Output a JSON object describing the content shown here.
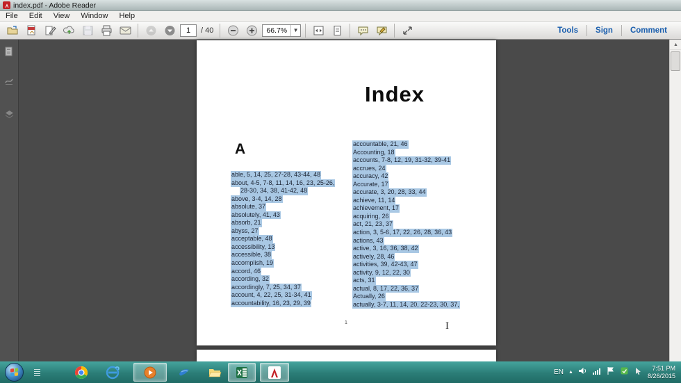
{
  "window": {
    "title": "index.pdf - Adobe Reader"
  },
  "menu": {
    "items": [
      "File",
      "Edit",
      "View",
      "Window",
      "Help"
    ]
  },
  "toolbar": {
    "icons": [
      "open-icon",
      "send-file-icon",
      "sign-pen-icon",
      "cloud-upload-icon",
      "save-icon",
      "print-icon",
      "email-icon",
      "previous-page-icon",
      "next-page-icon",
      "zoom-out-icon",
      "zoom-in-icon",
      "fit-width-icon",
      "fit-page-icon",
      "comment-bubble-icon",
      "annotate-bubble-icon",
      "fullscreen-icon"
    ],
    "page_current": "1",
    "page_total": "/ 40",
    "zoom_level": "66.7%",
    "right_buttons": [
      "Tools",
      "Sign",
      "Comment"
    ]
  },
  "sidebar": {
    "icons": [
      "page-thumbnails-icon",
      "signature-panel-icon",
      "layers-panel-icon"
    ]
  },
  "document": {
    "title": "Index",
    "section_letter": "A",
    "page_number": "1",
    "left_column": [
      {
        "text": "able, 5, 14, 25, 27-28, 43-44, 48"
      },
      {
        "text": "about, 4-5, 7-8, 11, 14, 16, 23, 25-26,"
      },
      {
        "text": "28-30, 34, 38, 41-42, 48",
        "indent": true
      },
      {
        "text": "above, 3-4, 14, 28"
      },
      {
        "text": "absolute, 37"
      },
      {
        "text": "absolutely, 41, 43"
      },
      {
        "text": "absorb, 21"
      },
      {
        "text": "abyss, 27"
      },
      {
        "text": "acceptable, 48"
      },
      {
        "text": "accessibility, 13"
      },
      {
        "text": "accessible, 38"
      },
      {
        "text": "accomplish, 19"
      },
      {
        "text": "accord, 46"
      },
      {
        "text": "according, 32"
      },
      {
        "text": "accordingly, 7, 25, 34, 37"
      },
      {
        "text": "account, 4, 22, 25, 31-34, 41"
      },
      {
        "text": "accountability, 16, 23, 29, 39"
      }
    ],
    "right_column": [
      {
        "text": "accountable, 21, 46"
      },
      {
        "text": "Accounting, 18"
      },
      {
        "text": "accounts, 7-8, 12, 19, 31-32, 39-41"
      },
      {
        "text": "accrues, 24"
      },
      {
        "text": "accuracy, 42"
      },
      {
        "text": "Accurate, 17"
      },
      {
        "text": "accurate, 3, 20, 28, 33, 44"
      },
      {
        "text": "achieve, 11, 14"
      },
      {
        "text": "achievement, 17"
      },
      {
        "text": "acquiring, 26"
      },
      {
        "text": "act, 21, 23, 37"
      },
      {
        "text": "action, 3, 5-6, 17, 22, 26, 28, 36, 43"
      },
      {
        "text": "actions, 43"
      },
      {
        "text": "active, 3, 16, 36, 38, 42"
      },
      {
        "text": "actively, 28, 46"
      },
      {
        "text": "activities, 39, 42-43, 47"
      },
      {
        "text": "activity, 9, 12, 22, 30"
      },
      {
        "text": "acts, 31"
      },
      {
        "text": "actual, 8, 17, 22, 36, 37"
      },
      {
        "text": "Actually, 26"
      },
      {
        "text": "actually, 3-7, 11, 14, 20, 22-23, 30, 37,"
      }
    ]
  },
  "taskbar": {
    "apps": [
      "start-orb",
      "list-app-icon",
      "chrome-icon",
      "internet-explorer-icon",
      "windows-media-player-icon",
      "messenger-icon",
      "explorer-folder-icon",
      "excel-icon",
      "adobe-reader-icon"
    ],
    "tray": {
      "language": "EN",
      "icons": [
        "hidden-icons-caret",
        "speaker-icon",
        "network-icon",
        "action-center-flag-icon",
        "update-icon",
        "pointer-icon"
      ],
      "time": "7:51 PM",
      "date": "8/26/2015"
    }
  },
  "colors": {
    "selection_highlight": "#a9c8e4",
    "toolbar_link_blue": "#1b5fae",
    "taskbar_teal": "#2f948d",
    "doc_background": "#4a4a4a"
  }
}
